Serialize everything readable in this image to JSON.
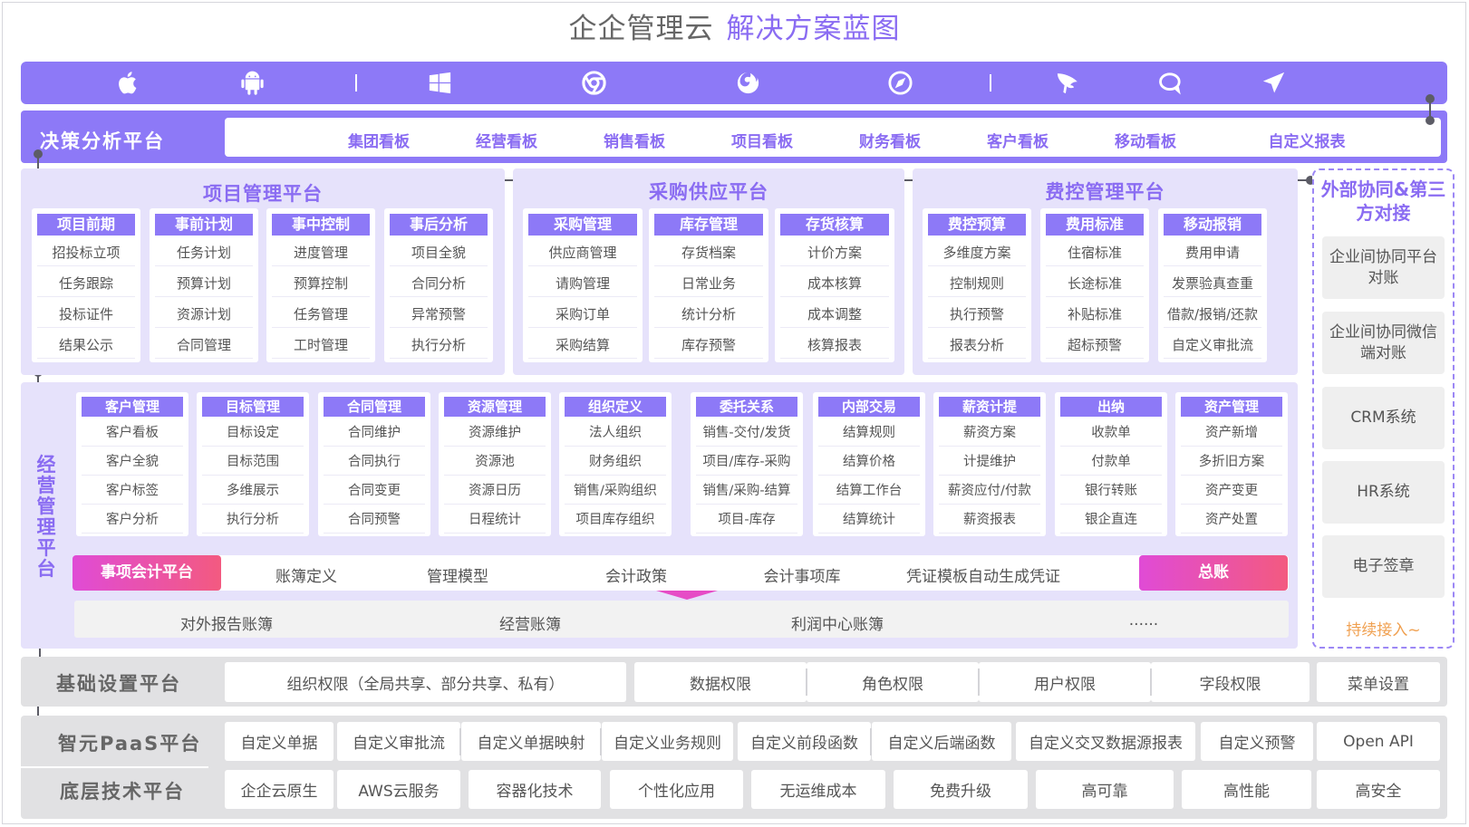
{
  "title": {
    "main": "企企管理云",
    "highlight": "解决方案蓝图"
  },
  "platform_icons": [
    "apple-icon",
    "android-icon",
    "windows-icon",
    "chrome-icon",
    "firefox-icon",
    "safari-icon",
    "feather-icon",
    "chat-bubble-icon",
    "send-icon"
  ],
  "decision": {
    "title": "决策分析平台",
    "items": [
      "集团看板",
      "经营看板",
      "销售看板",
      "项目看板",
      "财务看板",
      "客户看板",
      "移动看板",
      "自定义报表"
    ]
  },
  "project": {
    "title": "项目管理平台",
    "columns": [
      {
        "head": "项目前期",
        "items": [
          "招投标立项",
          "任务跟踪",
          "投标证件",
          "结果公示"
        ]
      },
      {
        "head": "事前计划",
        "items": [
          "任务计划",
          "预算计划",
          "资源计划",
          "合同管理"
        ]
      },
      {
        "head": "事中控制",
        "items": [
          "进度管理",
          "预算控制",
          "任务管理",
          "工时管理"
        ]
      },
      {
        "head": "事后分析",
        "items": [
          "项目全貌",
          "合同分析",
          "异常预警",
          "执行分析"
        ]
      }
    ]
  },
  "purchase": {
    "title": "采购供应平台",
    "columns": [
      {
        "head": "采购管理",
        "items": [
          "供应商管理",
          "请购管理",
          "采购订单",
          "采购结算"
        ]
      },
      {
        "head": "库存管理",
        "items": [
          "存货档案",
          "日常业务",
          "统计分析",
          "库存预警"
        ]
      },
      {
        "head": "存货核算",
        "items": [
          "计价方案",
          "成本核算",
          "成本调整",
          "核算报表"
        ]
      }
    ]
  },
  "expense": {
    "title": "费控管理平台",
    "columns": [
      {
        "head": "费控预算",
        "items": [
          "多维度方案",
          "控制规则",
          "执行预警",
          "报表分析"
        ]
      },
      {
        "head": "费用标准",
        "items": [
          "住宿标准",
          "长途标准",
          "补贴标准",
          "超标预警"
        ]
      },
      {
        "head": "移动报销",
        "items": [
          "费用申请",
          "发票验真查重",
          "借款/报销/还款",
          "自定义审批流"
        ]
      }
    ]
  },
  "external": {
    "title": "外部协同&第三方对接",
    "items": [
      "企业间协同平台对账",
      "企业间协同微信端对账",
      "CRM系统",
      "HR系统",
      "电子签章"
    ],
    "more": "持续接入~"
  },
  "operation": {
    "title": "经营管理平台",
    "columns": [
      {
        "head": "客户管理",
        "items": [
          "客户看板",
          "客户全貌",
          "客户标签",
          "客户分析"
        ]
      },
      {
        "head": "目标管理",
        "items": [
          "目标设定",
          "目标范围",
          "多维展示",
          "执行分析"
        ]
      },
      {
        "head": "合同管理",
        "items": [
          "合同维护",
          "合同执行",
          "合同变更",
          "合同预警"
        ]
      },
      {
        "head": "资源管理",
        "items": [
          "资源维护",
          "资源池",
          "资源日历",
          "日程统计"
        ]
      },
      {
        "head": "组织定义",
        "items": [
          "法人组织",
          "财务组织",
          "销售/采购组织",
          "项目库存组织"
        ]
      },
      {
        "head": "委托关系",
        "items": [
          "销售-交付/发货",
          "项目/库存-采购",
          "销售/采购-结算",
          "项目-库存"
        ]
      },
      {
        "head": "内部交易",
        "items": [
          "结算规则",
          "结算价格",
          "结算工作台",
          "结算统计"
        ]
      },
      {
        "head": "薪资计提",
        "items": [
          "薪资方案",
          "计提维护",
          "薪资应付/付款",
          "薪资报表"
        ]
      },
      {
        "head": "出纳",
        "items": [
          "收款单",
          "付款单",
          "银行转账",
          "银企直连"
        ]
      },
      {
        "head": "资产管理",
        "items": [
          "资产新增",
          "多折旧方案",
          "资产变更",
          "资产处置"
        ]
      }
    ]
  },
  "accounting": {
    "left": "事项会计平台",
    "items": [
      "账簿定义",
      "管理模型",
      "会计政策",
      "会计事项库",
      "凭证模板自动生成凭证"
    ],
    "right": "总账"
  },
  "ledgers": [
    "对外报告账簿",
    "经营账簿",
    "利润中心账簿",
    "......"
  ],
  "basic": {
    "title": "基础设置平台",
    "items": [
      "组织权限（全局共享、部分共享、私有）",
      "数据权限",
      "角色权限",
      "用户权限",
      "字段权限",
      "菜单设置"
    ]
  },
  "paas": {
    "title": "智元PaaS平台",
    "items": [
      "自定义单据",
      "自定义审批流",
      "自定义单据映射",
      "自定义业务规则",
      "自定义前段函数",
      "自定义后端函数",
      "自定义交叉数据源报表",
      "自定义预警",
      "Open API"
    ]
  },
  "tech": {
    "title": "底层技术平台",
    "items": [
      "企企云原生",
      "AWS云服务",
      "容器化技术",
      "个性化应用",
      "无运维成本",
      "免费升级",
      "高可靠",
      "高性能",
      "高安全"
    ]
  },
  "colors": {
    "accent": "#8d79f7",
    "panel": "#e6e2fb",
    "pink": "#e64cc6",
    "orange": "#f0a050"
  }
}
